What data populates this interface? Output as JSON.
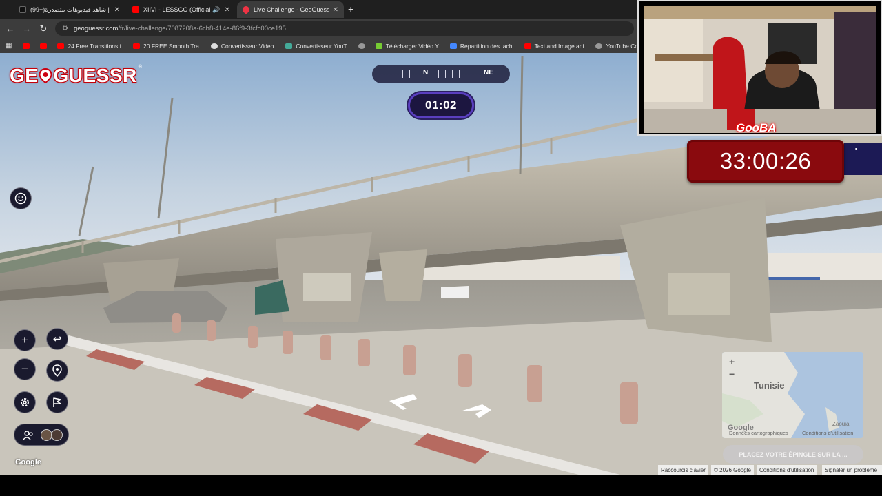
{
  "browser": {
    "tabs": [
      {
        "title": "(99+)شاهد فيديوهات متصدرة | ",
        "icon": "tiktok-icon",
        "color": "#ffffff"
      },
      {
        "title": "XIIVI - LESSGO (Official Mu",
        "icon": "youtube-icon",
        "color": "#ff0000"
      },
      {
        "title": "Live Challenge - GeoGuessr",
        "icon": "geoguessr-pin-icon",
        "color": "#ee3344"
      }
    ],
    "url_host": "geoguessr.com",
    "url_path": "/fr/live-challenge/7087208a-6cb8-414e-86f9-3fcfc00ce195",
    "bookmarks": [
      {
        "label": "",
        "icon": "youtube-icon"
      },
      {
        "label": "",
        "icon": "youtube-icon"
      },
      {
        "label": "24 Free Transitions f...",
        "icon": "youtube-icon"
      },
      {
        "label": "20 FREE Smooth Tra...",
        "icon": "youtube-icon"
      },
      {
        "label": "Convertisseur Video...",
        "icon": "chrome-icon"
      },
      {
        "label": "Convertisseur YouT...",
        "icon": "converter-icon"
      },
      {
        "label": "",
        "icon": "globe-icon"
      },
      {
        "label": "Télécharger Vidéo Y...",
        "icon": "download-icon"
      },
      {
        "label": "Repartition des tach...",
        "icon": "docs-icon"
      },
      {
        "label": "Text and Image ani...",
        "icon": "youtube-icon"
      },
      {
        "label": "YouTube Converter...",
        "icon": "globe-icon"
      }
    ]
  },
  "game": {
    "logo_text_left": "GE",
    "logo_text_right": "GUESSR",
    "logo_reg": "®",
    "compass_north": "N",
    "compass_northeast": "NE",
    "round_timer": "01:02",
    "controls": {
      "zoom_in": "+",
      "zoom_out": "−",
      "undo": "↩"
    },
    "minimap": {
      "zoom_in": "+",
      "zoom_out": "−",
      "country_label": "Tunisie",
      "town_label": "Zaouia",
      "map_logo": "Google",
      "attribution": "Données cartographiques",
      "terms": "Conditions d'utilisation"
    },
    "guess_button": "PLACEZ VOTRE ÉPINGLE SUR LA ...",
    "google_logo": "Google",
    "footer": {
      "shortcuts": "Raccourcis clavier",
      "copyright": "© 2026 Google",
      "terms": "Conditions d'utilisation",
      "report": "Signaler un problème"
    }
  },
  "overlay": {
    "streamer_name": "GooBA",
    "challenge_timer": "33:00:26"
  }
}
